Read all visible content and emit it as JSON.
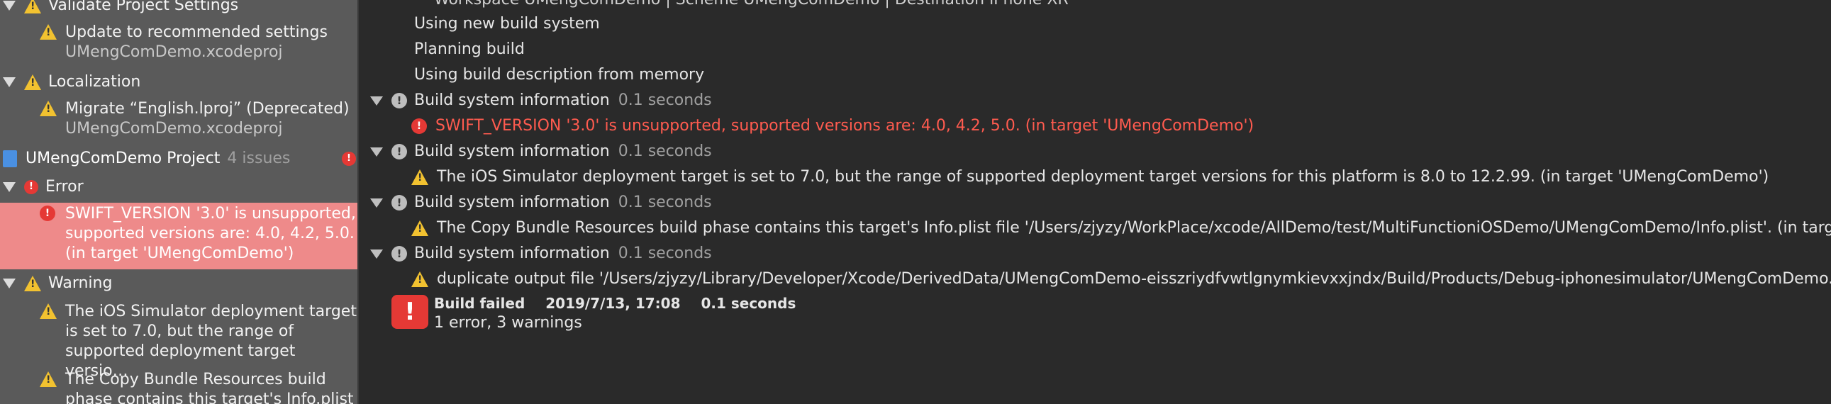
{
  "sidebar": {
    "validate": {
      "title": "Validate Project Settings",
      "issue": "Update to recommended settings",
      "file": "UMengComDemo.xcodeproj"
    },
    "localization": {
      "title": "Localization",
      "issue": "Migrate “English.lproj” (Deprecated)",
      "file": "UMengComDemo.xcodeproj"
    },
    "project": {
      "name": "UMengComDemo Project",
      "count": "4 issues"
    },
    "error_group": {
      "title": "Error",
      "items": [
        {
          "l1": "SWIFT_VERSION '3.0' is unsupported,",
          "l2": "supported versions are: 4.0, 4.2, 5.0.",
          "l3": "(in target 'UMengComDemo')"
        }
      ]
    },
    "warning_group": {
      "title": "Warning",
      "items": [
        {
          "l1": "The iOS Simulator deployment target",
          "l2": "is set to 7.0, but the range of",
          "l3": "supported deployment target versio…"
        },
        {
          "l1": "The Copy Bundle Resources build",
          "l2": "phase contains this target's Info.plist"
        }
      ]
    }
  },
  "log": {
    "top_partial": "Workspace UMengComDemo | Scheme UMengComDemo | Destination iPhone XR",
    "lines": [
      "Using new build system",
      "Planning build",
      "Using build description from memory"
    ],
    "sections": [
      {
        "title": "Build system information",
        "time": "0.1 seconds",
        "msg": "SWIFT_VERSION '3.0' is unsupported, supported versions are: 4.0, 4.2, 5.0. (in target 'UMengComDemo')"
      },
      {
        "title": "Build system information",
        "time": "0.1 seconds",
        "msg": "The iOS Simulator deployment target is set to 7.0, but the range of supported deployment target versions for this platform is 8.0 to 12.2.99. (in target 'UMengComDemo')"
      },
      {
        "title": "Build system information",
        "time": "0.1 seconds",
        "msg": "The Copy Bundle Resources build phase contains this target's Info.plist file '/Users/zjyzy/WorkPlace/xcode/AllDemo/test/MultiFunctioniOSDemo/UMengComDemo/Info.plist'. (in target 'UMengComDemo')"
      },
      {
        "title": "Build system information",
        "time": "0.1 seconds",
        "msg": "duplicate output file '/Users/zjyzy/Library/Developer/Xcode/DerivedData/UMengComDemo-eisszriydfvwtlgnymkievxxjndx/Build/Products/Debug-iphonesimulator/UMengComDemo.app/Info.plist' on task: ProcessInfoPlistFile"
      }
    ],
    "result": {
      "status": "Build failed",
      "date": "2019/7/13, 17:08",
      "duration": "0.1 seconds",
      "summary": "1 error, 3 warnings"
    }
  }
}
